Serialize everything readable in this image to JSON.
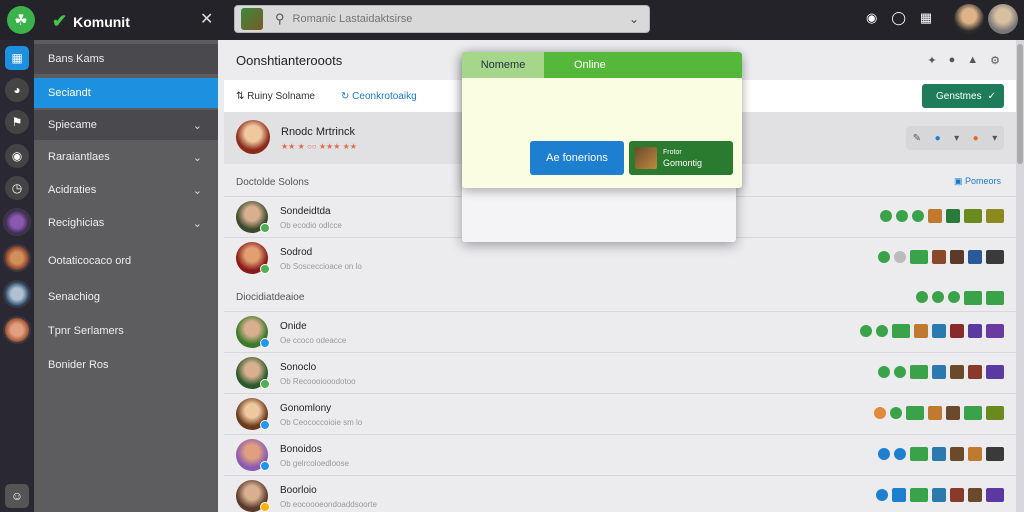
{
  "app": {
    "name": "Komunit"
  },
  "search": {
    "placeholder": "Romanic Lastaidaktsirse"
  },
  "sidebar": {
    "items": [
      {
        "label": "Bans Kams",
        "chevron": false
      },
      {
        "label": "Seciandt",
        "chevron": false,
        "active": true
      },
      {
        "label": "Spiecame",
        "chevron": true
      },
      {
        "label": "Raraiantlaes",
        "chevron": true
      },
      {
        "label": "Acidraties",
        "chevron": true
      },
      {
        "label": "Recighicias",
        "chevron": true
      },
      {
        "label": "Ootaticocaco ord",
        "chevron": false
      },
      {
        "label": "Senachiog",
        "chevron": false
      },
      {
        "label": "Tpnr Serlamers",
        "chevron": false
      },
      {
        "label": "Bonider Ros",
        "chevron": false
      }
    ]
  },
  "main": {
    "title": "Oonshtianterooots",
    "subbar": {
      "left": "Ruiny Solname",
      "right": "Ceonkrotoaikg"
    },
    "action_button": "Genstmes",
    "me": {
      "name": "Rnodc Mrtrinck",
      "status": "★★ ★ ○○ ★★★ ★★"
    },
    "section1": {
      "label": "Doctolde Solons",
      "right": "Pomeors"
    },
    "section2": {
      "label": "Diocidiatdeaioe"
    },
    "friends": [
      {
        "name": "Sondeidtda",
        "status": "Ob ecodio odlcce",
        "badge": "#4caf50"
      },
      {
        "name": "Sodrod",
        "status": "Ob Sosceccioace on lo",
        "badge": "#4caf50"
      },
      {
        "name": "Onide",
        "status": "Oe ccoco odeacce",
        "badge": "#2196f3"
      },
      {
        "name": "Sonoclo",
        "status": "Ob Recoooiooodotoo",
        "badge": "#4caf50"
      },
      {
        "name": "Gonomlony",
        "status": "Ob Ceococcoioie sm lo",
        "badge": "#2196f3"
      },
      {
        "name": "Bonoidos",
        "status": "Ob gelrcoloedloose",
        "badge": "#2196f3"
      },
      {
        "name": "Boorloio",
        "status": "Ob eocoooeondoaddsoorte",
        "badge": "#ffb300"
      }
    ]
  },
  "popup": {
    "tab1": "Nomeme",
    "tab2": "Online",
    "button1": "Ae fonerions",
    "button2_line1": "Frotor",
    "button2_line2": "Gomontig"
  },
  "colors": {
    "accent": "#1e90e0",
    "online": "#4caf50",
    "brand": "#3bb34a",
    "popup_bg": "#fbfde3"
  }
}
